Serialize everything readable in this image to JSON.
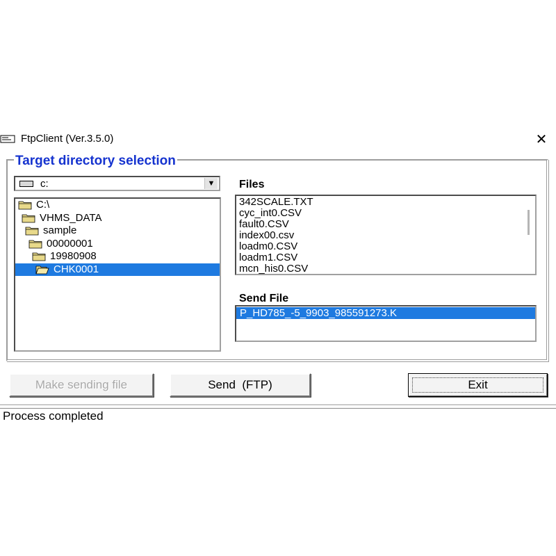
{
  "window": {
    "title": "FtpClient (Ver.3.5.0)"
  },
  "directory": {
    "group_title": "Target directory selection",
    "drive": "c:",
    "tree": [
      {
        "label": "C:\\",
        "depth": 0,
        "selected": false
      },
      {
        "label": "VHMS_DATA",
        "depth": 1,
        "selected": false
      },
      {
        "label": "sample",
        "depth": 2,
        "selected": false
      },
      {
        "label": "00000001",
        "depth": 3,
        "selected": false
      },
      {
        "label": "19980908",
        "depth": 4,
        "selected": false
      },
      {
        "label": "CHK0001",
        "depth": 5,
        "selected": true
      }
    ]
  },
  "files": {
    "label": "Files",
    "items": [
      "342SCALE.TXT",
      "cyc_int0.CSV",
      "fault0.CSV",
      "index00.csv",
      "loadm0.CSV",
      "loadm1.CSV",
      "mcn_his0.CSV"
    ]
  },
  "send": {
    "label": "Send File",
    "selected_file": "P_HD785_-5_9903_985591273.K"
  },
  "buttons": {
    "make_sending_file": "Make sending file",
    "send_ftp": "Send  (FTP)",
    "exit": "Exit"
  },
  "status": {
    "text": "Process completed"
  },
  "colors": {
    "group_title": "#1533cf",
    "selection": "#1e7ae0"
  },
  "icons": {
    "app": "ftp-window-icon",
    "close": "close-icon",
    "drive": "drive-icon",
    "folder": "folder-icon",
    "folder_open": "folder-open-icon",
    "dropdown": "chevron-down-icon"
  }
}
